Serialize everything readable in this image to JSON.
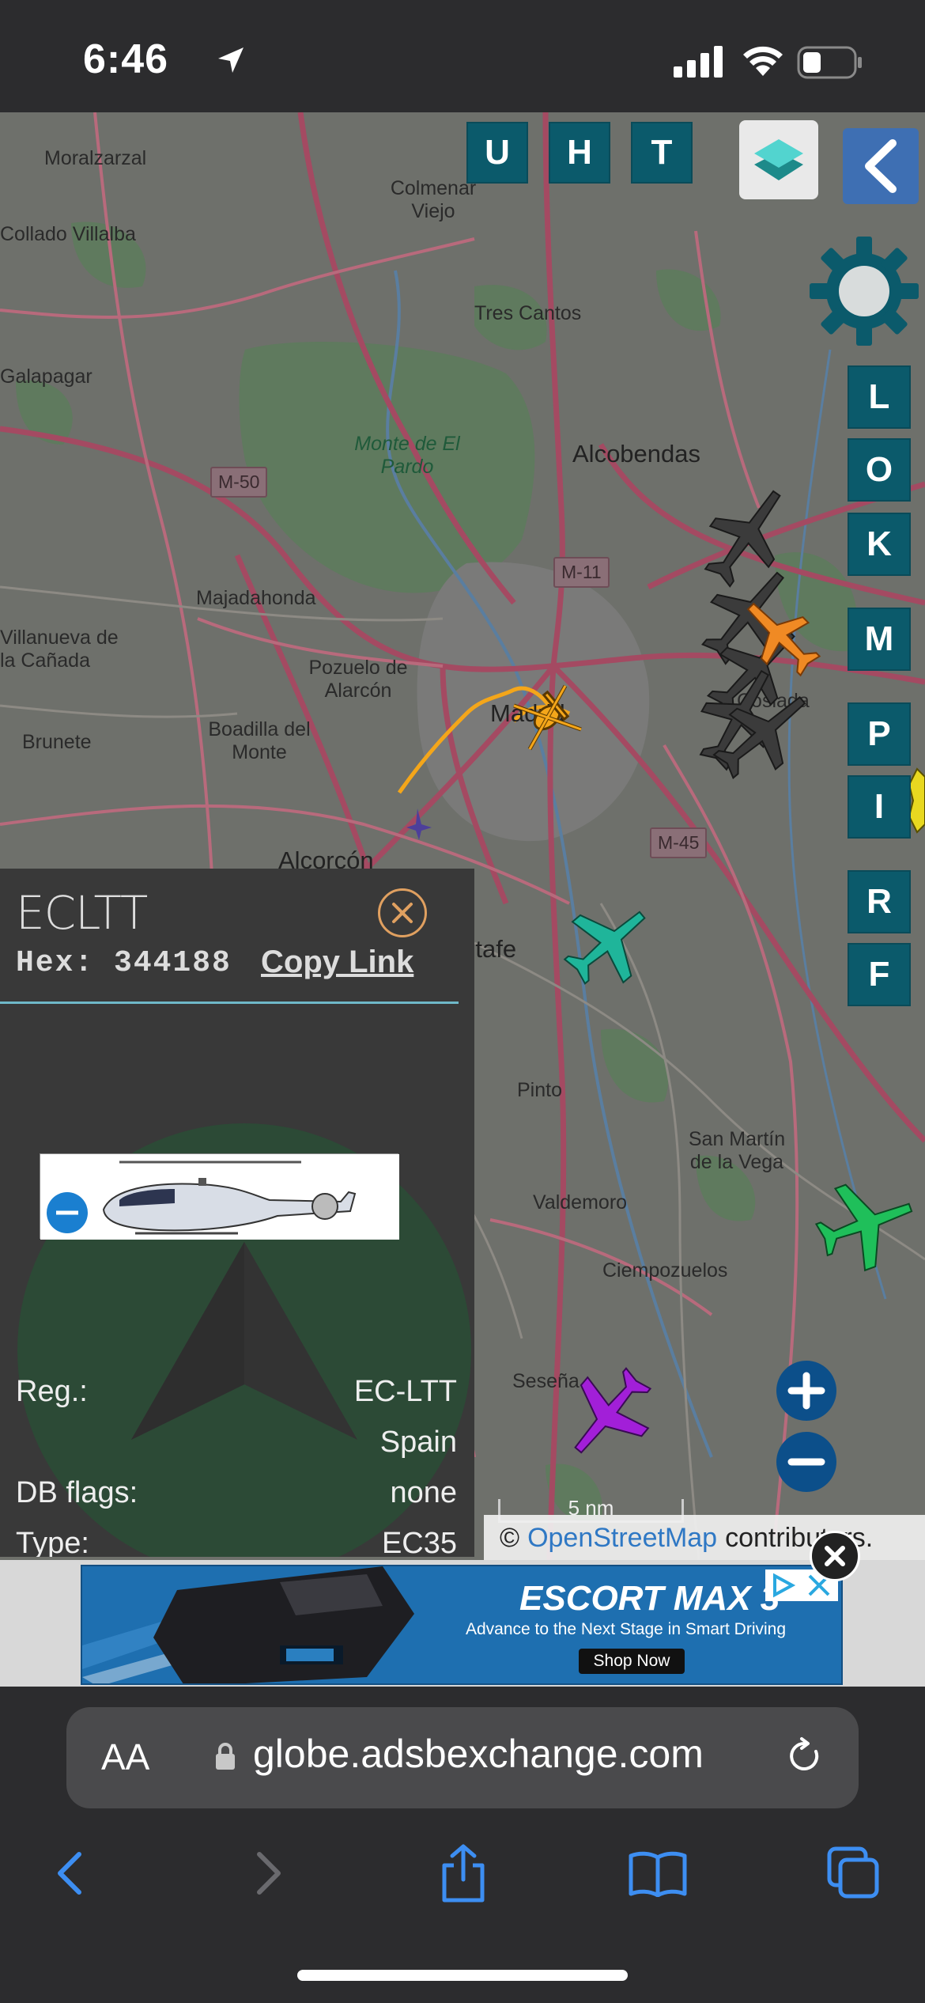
{
  "status_bar": {
    "time": "6:46"
  },
  "map": {
    "place_labels": [
      "Moralzarzal",
      "Colmenar Viejo",
      "Collado Villalba",
      "Tres Cantos",
      "Galapagar",
      "Monte de El Pardo",
      "Alcobendas",
      "Majadahonda",
      "Villanueva de la Cañada",
      "Pozuelo de Alarcón",
      "Brunete",
      "Boadilla del Monte",
      "Madrid",
      "Coslada",
      "Alcorcón",
      "Getafe",
      "Pinto",
      "San Martín de la Vega",
      "Valdemoro",
      "Ciempozuelos",
      "Seseña"
    ],
    "road_shields": [
      "M-50",
      "M-11",
      "M-45"
    ],
    "top_buttons": [
      "U",
      "H",
      "T"
    ],
    "side_buttons": [
      "L",
      "O",
      "K",
      "M",
      "P",
      "I",
      "R",
      "F"
    ],
    "scale_label": "5 nm",
    "attribution": {
      "prefix": "©",
      "link": "OpenStreetMap",
      "suffix": "contributors."
    },
    "aircraft_colors": {
      "selected": "#f4a61a",
      "cluster": "#3a3a3a",
      "cluster_highlight": "#f08a24",
      "teal": "#1fb59a",
      "green": "#1fbf5a",
      "purple": "#a21fd8"
    }
  },
  "info_panel": {
    "callsign": "ECLTT",
    "hex_label": "Hex: 344188",
    "copy_link": "Copy Link",
    "rows": [
      {
        "key": "Reg.:",
        "value": "EC-LTT"
      },
      {
        "key": "",
        "value": "Spain"
      },
      {
        "key": "DB flags:",
        "value": "none"
      },
      {
        "key": "Type:",
        "value": "EC35"
      }
    ]
  },
  "ad": {
    "title": "ESCORT MAX 3",
    "subtitle": "Advance to the Next Stage in Smart Driving",
    "cta": "Shop Now"
  },
  "browser": {
    "text_size_label": "AA",
    "url": "globe.adsbexchange.com"
  }
}
